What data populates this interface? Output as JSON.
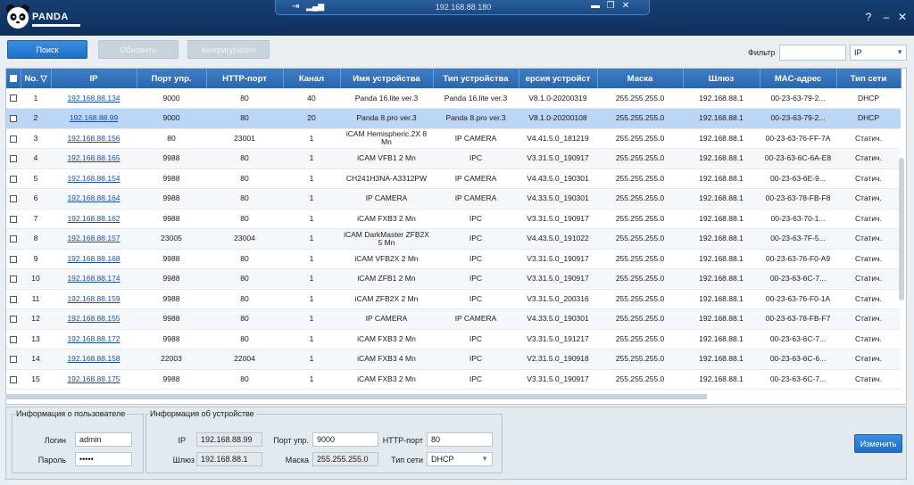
{
  "header": {
    "brand": "PANDA",
    "address": "192.168.88.180",
    "help": "?",
    "minimize": "–",
    "close": "✕",
    "addr_pin": "⇥",
    "addr_minimize": "▬",
    "addr_restore": "❐",
    "addr_close": "✕"
  },
  "toolbar": {
    "search_label": "Поиск",
    "update_label": "Обновить",
    "config_label": "Конфигурация",
    "filter_label": "Фильтр",
    "filter_value": "",
    "filter_select": "IP"
  },
  "table": {
    "columns": [
      "No.",
      "IP",
      "Порт упр.",
      "HTTP-порт",
      "Канал",
      "Имя устройства",
      "Тип устройства",
      "ерсия устройст",
      "Маска",
      "Шлюз",
      "MAC-адрес",
      "Тип сети"
    ],
    "rows": [
      {
        "no": "1",
        "ip": "192.168.88.134",
        "port": "9000",
        "http": "80",
        "channel": "40",
        "name": "Panda 16.lite ver.3",
        "type": "Panda 16.lite ver.3",
        "version": "V8.1.0-20200319",
        "mask": "255.255.255.0",
        "gateway": "192.168.88.1",
        "mac": "00-23-63-79-2...",
        "net": "DHCP"
      },
      {
        "no": "2",
        "ip": "192.168.88.99",
        "port": "9000",
        "http": "80",
        "channel": "20",
        "name": "Panda 8.pro ver.3",
        "type": "Panda 8.pro ver.3",
        "version": "V8.1.0-20200108",
        "mask": "255.255.255.0",
        "gateway": "192.168.88.1",
        "mac": "00-23-63-79-2...",
        "net": "DHCP"
      },
      {
        "no": "3",
        "ip": "192.168.88.156",
        "port": "80",
        "http": "23001",
        "channel": "1",
        "name": "iCAM Hemispheric.2X 8 Mn",
        "type": "IP CAMERA",
        "version": "V4.41.5.0_181219",
        "mask": "255.255.255.0",
        "gateway": "192.168.88.1",
        "mac": "00-23-63-76-FF-7A",
        "net": "Статич."
      },
      {
        "no": "4",
        "ip": "192.168.88.165",
        "port": "9988",
        "http": "80",
        "channel": "1",
        "name": "iCAM VFB1 2 Mn",
        "type": "IPC",
        "version": "V3.31.5.0_190917",
        "mask": "255.255.255.0",
        "gateway": "192.168.88.1",
        "mac": "00-23-63-6C-6A-E8",
        "net": "Статич."
      },
      {
        "no": "5",
        "ip": "192.168.88.154",
        "port": "9988",
        "http": "80",
        "channel": "1",
        "name": "CH241H3NA-A3312PW",
        "type": "IP CAMERA",
        "version": "V4.43.5.0_190301",
        "mask": "255.255.255.0",
        "gateway": "192.168.88.1",
        "mac": "00-23-63-6E-9...",
        "net": "Статич."
      },
      {
        "no": "6",
        "ip": "192.168.88.164",
        "port": "9988",
        "http": "80",
        "channel": "1",
        "name": "IP CAMERA",
        "type": "IP CAMERA",
        "version": "V4.33.5.0_190301",
        "mask": "255.255.255.0",
        "gateway": "192.168.88.1",
        "mac": "00-23-63-78-FB-F8",
        "net": "Статич."
      },
      {
        "no": "7",
        "ip": "192.168.88.162",
        "port": "9988",
        "http": "80",
        "channel": "1",
        "name": "iCAM FXB3 2 Mn",
        "type": "IPC",
        "version": "V3.31.5.0_190917",
        "mask": "255.255.255.0",
        "gateway": "192.168.88.1",
        "mac": "00-23-63-70-1...",
        "net": "Статич."
      },
      {
        "no": "8",
        "ip": "192.168.88.157",
        "port": "23005",
        "http": "23004",
        "channel": "1",
        "name": "iCAM DarkMaster ZFB2X 5 Mn",
        "type": "IPC",
        "version": "V4.43.5.0_191022",
        "mask": "255.255.255.0",
        "gateway": "192.168.88.1",
        "mac": "00-23-63-7F-5...",
        "net": "Статич."
      },
      {
        "no": "9",
        "ip": "192.168.88.168",
        "port": "9988",
        "http": "80",
        "channel": "1",
        "name": "iCAM VFB2X 2 Mn",
        "type": "IPC",
        "version": "V3.31.5.0_190917",
        "mask": "255.255.255.0",
        "gateway": "192.168.88.1",
        "mac": "00-23-63-76-F0-A9",
        "net": "Статич."
      },
      {
        "no": "10",
        "ip": "192.168.88.174",
        "port": "9988",
        "http": "80",
        "channel": "1",
        "name": "iCAM ZFB1 2 Mn",
        "type": "IPC",
        "version": "V3.31.5.0_190917",
        "mask": "255.255.255.0",
        "gateway": "192.168.88.1",
        "mac": "00-23-63-6C-7...",
        "net": "Статич."
      },
      {
        "no": "11",
        "ip": "192.168.88.159",
        "port": "9988",
        "http": "80",
        "channel": "1",
        "name": "iCAM ZFB2X 2 Mn",
        "type": "IPC",
        "version": "V3.31.5.0_200316",
        "mask": "255.255.255.0",
        "gateway": "192.168.88.1",
        "mac": "00-23-63-76-F0-1A",
        "net": "Статич."
      },
      {
        "no": "12",
        "ip": "192.168.88.155",
        "port": "9988",
        "http": "80",
        "channel": "1",
        "name": "IP CAMERA",
        "type": "IP CAMERA",
        "version": "V4.33.5.0_190301",
        "mask": "255.255.255.0",
        "gateway": "192.168.88.1",
        "mac": "00-23-63-78-FB-F7",
        "net": "Статич."
      },
      {
        "no": "13",
        "ip": "192.168.88.172",
        "port": "9988",
        "http": "80",
        "channel": "1",
        "name": "iCAM FXB3 2 Mn",
        "type": "IPC",
        "version": "V3.31.5.0_191217",
        "mask": "255.255.255.0",
        "gateway": "192.168.88.1",
        "mac": "00-23-63-6C-7...",
        "net": "Статич."
      },
      {
        "no": "14",
        "ip": "192.168.88.158",
        "port": "22003",
        "http": "22004",
        "channel": "1",
        "name": "iCAM FXB3 4 Mn",
        "type": "IPC",
        "version": "V2.31.5.0_190918",
        "mask": "255.255.255.0",
        "gateway": "192.168.88.1",
        "mac": "00-23-63-6C-6...",
        "net": "Статич."
      },
      {
        "no": "15",
        "ip": "192.168.88.175",
        "port": "9988",
        "http": "80",
        "channel": "1",
        "name": "iCAM FXB3 2 Mn",
        "type": "IPC",
        "version": "V3.31.5.0_190917",
        "mask": "255.255.255.0",
        "gateway": "192.168.88.1",
        "mac": "00-23-63-6C-7...",
        "net": "Статич."
      }
    ]
  },
  "user_info": {
    "legend": "Информация о пользователе",
    "login_label": "Логин",
    "login_value": "admin",
    "password_label": "Пароль",
    "password_value": "•••••"
  },
  "device_info": {
    "legend": "Информация об устройстве",
    "ip_label": "IP",
    "ip_value": "192.168.88.99",
    "port_label": "Порт упр.",
    "port_value": "9000",
    "http_label": "HTTP-порт",
    "http_value": "80",
    "gateway_label": "Шлюз",
    "gateway_value": "192.168.88.1",
    "mask_label": "Маска",
    "mask_value": "255.255.255.0",
    "net_label": "Тип сети",
    "net_value": "DHCP"
  },
  "change_label": "Изменить"
}
